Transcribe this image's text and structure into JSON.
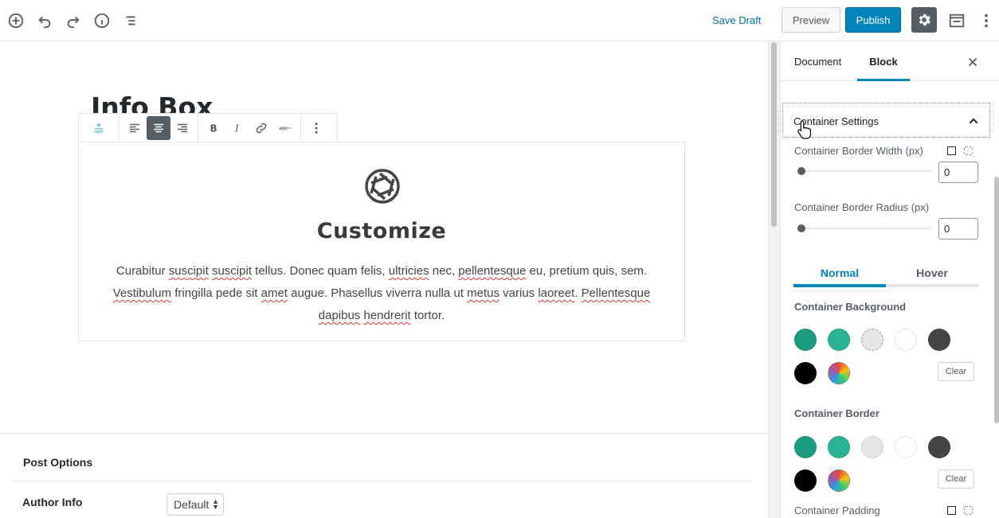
{
  "toolbar": {
    "add_icon": "plus-circle-icon",
    "undo_icon": "undo-icon",
    "redo_icon": "redo-icon",
    "info_icon": "info-icon",
    "outline_icon": "list-outline-icon",
    "save_draft": "Save Draft",
    "preview": "Preview",
    "publish": "Publish",
    "settings_icon": "gear-icon",
    "fullscreen_icon": "fullwidth-icon",
    "more_icon": "more-vertical-icon",
    "accent_color": "#0085ba"
  },
  "editor": {
    "post_title": "Info Box",
    "block_toolbar": {
      "block_icon": "infobox-block-icon",
      "align_left": "align-left-icon",
      "align_center": "align-center-icon",
      "align_right": "align-right-icon",
      "bold": "bold-icon",
      "italic": "italic-icon",
      "link": "link-icon",
      "strikethrough": "strikethrough-icon",
      "more": "more-vertical-icon"
    },
    "infobox": {
      "icon": "aperture-icon",
      "title": "Customize",
      "desc_parts": [
        "Curabitur ",
        "suscipit",
        " ",
        "suscipit",
        " tellus. Donec quam felis, ",
        "ultricies",
        " nec, ",
        "pellentesque",
        " eu, pretium quis, sem. ",
        "Vestibulum",
        " fringilla pede sit ",
        "amet",
        " augue. Phasellus viverra nulla ut ",
        "metus",
        " varius ",
        "laoreet",
        ". ",
        "Pellentesque",
        " ",
        "dapibus",
        " ",
        "hendrerit",
        " tortor."
      ]
    },
    "post_options": {
      "title": "Post Options",
      "author_label": "Author Info",
      "author_value": "Default"
    }
  },
  "sidebar": {
    "tabs": [
      "Document",
      "Block"
    ],
    "active_tab": "Block",
    "close_icon": "close-icon",
    "panel": {
      "title": "Container Settings",
      "chevron_icon": "chevron-up-icon",
      "border_width_label": "Container Border Width (px)",
      "border_width_value": "0",
      "border_radius_label": "Container Border Radius (px)",
      "border_radius_value": "0",
      "state_tabs": [
        "Normal",
        "Hover"
      ],
      "background_label": "Container Background",
      "border_label": "Container Border",
      "padding_label": "Container Padding",
      "clear_label": "Clear",
      "swatches": [
        "#1a9c80",
        "#29b294",
        "#e6e6e6",
        "#ffffff",
        "#444444",
        "#000000",
        "gradient"
      ]
    }
  }
}
